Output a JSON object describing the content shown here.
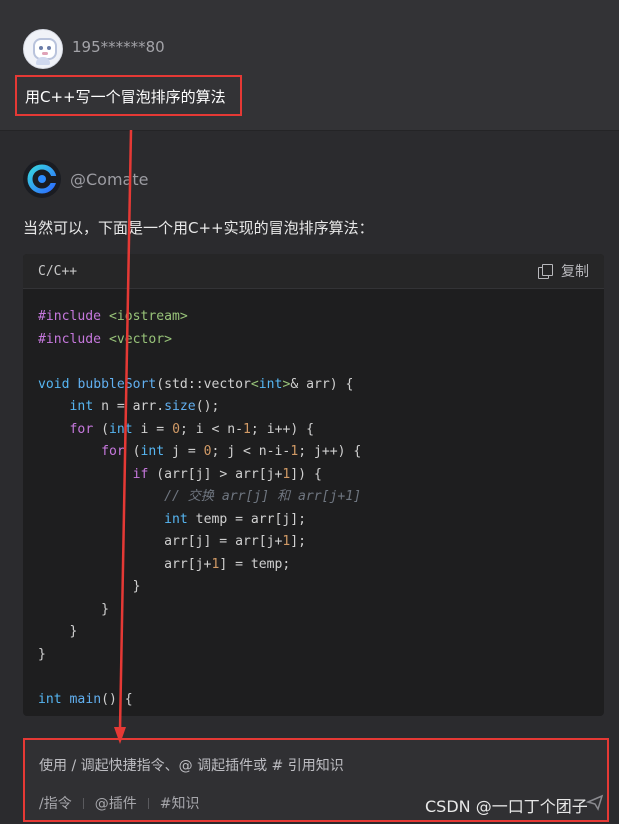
{
  "user": {
    "name": "195******80",
    "question": "用C++写一个冒泡排序的算法"
  },
  "bot": {
    "name": "@Comate",
    "intro": "当然可以，下面是一个用C++实现的冒泡排序算法："
  },
  "code_block": {
    "language": "C/C++",
    "copy_label": "复制"
  },
  "input": {
    "placeholder": "使用 / 调起快捷指令、@ 调起插件或 # 引用知识",
    "shortcuts": [
      "/指令",
      "@插件",
      "#知识"
    ]
  },
  "watermark": "CSDN @一口丁个团子",
  "icons": {
    "user_avatar": "robot-avatar-icon",
    "bot_avatar": "comate-logo-icon",
    "copy": "copy-icon",
    "send": "send-icon"
  },
  "colors": {
    "highlight_box": "#e53935",
    "bot_logo_blue": "#2d8cff",
    "bot_logo_cyan": "#37d4e0"
  }
}
